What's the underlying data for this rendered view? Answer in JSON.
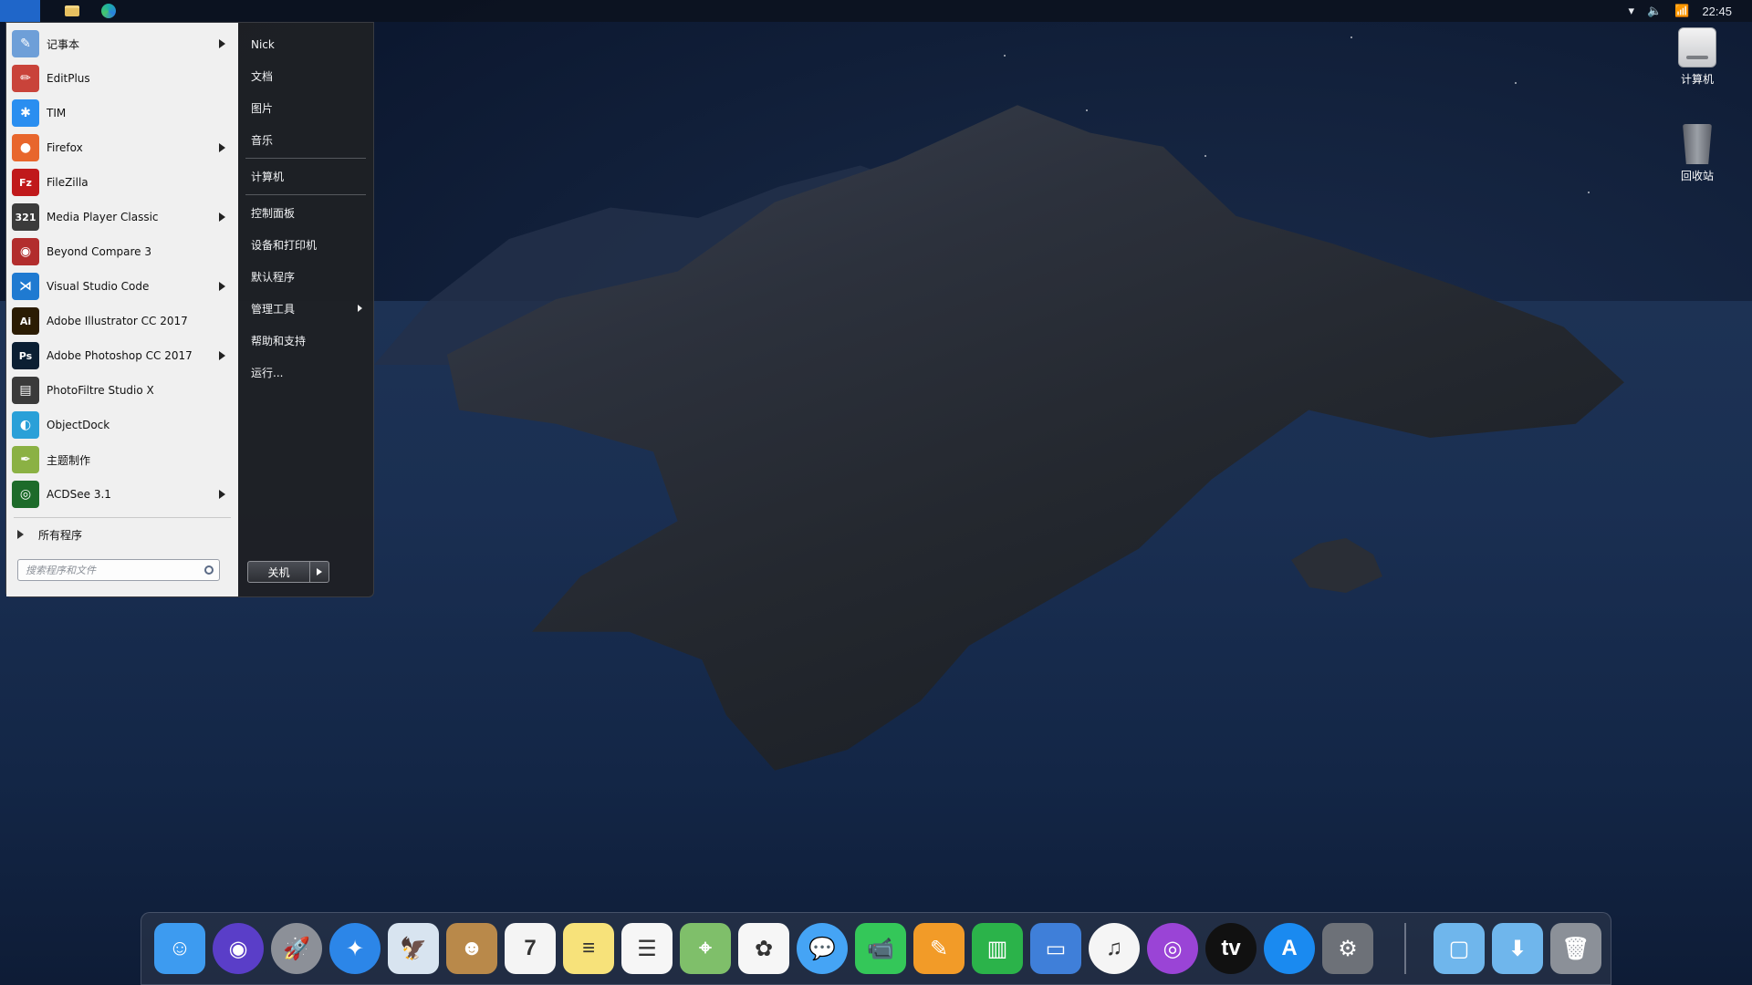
{
  "menubar": {
    "apple_glyph": "",
    "left_icons": [
      "folder-icon",
      "edge-browser-icon"
    ],
    "tray": {
      "dropdown_glyph": "▾",
      "volume_glyph": "🔈",
      "signal_glyph": "📶",
      "time": "22:45"
    }
  },
  "desktop_icons": [
    {
      "label": "计算机",
      "icon": "computer-drive-icon"
    },
    {
      "label": "回收站",
      "icon": "recycle-bin-icon"
    }
  ],
  "start_menu": {
    "programs": [
      {
        "label": "记事本",
        "icon": "notepad-icon",
        "has_submenu": true,
        "color": "#6e9fd8",
        "glyph": "✎"
      },
      {
        "label": "EditPlus",
        "icon": "editplus-icon",
        "has_submenu": false,
        "color": "#c9433a",
        "glyph": "✏"
      },
      {
        "label": "TIM",
        "icon": "tim-icon",
        "has_submenu": false,
        "color": "#2a8ef0",
        "glyph": "✱"
      },
      {
        "label": "Firefox",
        "icon": "firefox-icon",
        "has_submenu": true,
        "color": "#e8662c",
        "glyph": "●"
      },
      {
        "label": "FileZilla",
        "icon": "filezilla-icon",
        "has_submenu": false,
        "color": "#c0191b",
        "glyph": "Fz"
      },
      {
        "label": "Media Player Classic",
        "icon": "media-player-icon",
        "has_submenu": true,
        "color": "#3b3b3b",
        "glyph": "321"
      },
      {
        "label": "Beyond Compare 3",
        "icon": "beyond-compare-icon",
        "has_submenu": false,
        "color": "#b22d2d",
        "glyph": "◉"
      },
      {
        "label": "Visual Studio Code",
        "icon": "vscode-icon",
        "has_submenu": true,
        "color": "#1f7ad1",
        "glyph": "⋊"
      },
      {
        "label": "Adobe Illustrator CC 2017",
        "icon": "illustrator-icon",
        "has_submenu": false,
        "color": "#2b1c03",
        "glyph": "Ai"
      },
      {
        "label": "Adobe Photoshop CC 2017",
        "icon": "photoshop-icon",
        "has_submenu": true,
        "color": "#0b1f33",
        "glyph": "Ps"
      },
      {
        "label": "PhotoFiltre Studio X",
        "icon": "photofiltre-icon",
        "has_submenu": false,
        "color": "#3a3a3a",
        "glyph": "▤"
      },
      {
        "label": "ObjectDock",
        "icon": "objectdock-icon",
        "has_submenu": false,
        "color": "#2aa0d8",
        "glyph": "◐"
      },
      {
        "label": "主题制作",
        "icon": "theme-maker-icon",
        "has_submenu": false,
        "color": "#8bb144",
        "glyph": "✒"
      },
      {
        "label": "ACDSee 3.1",
        "icon": "acdsee-icon",
        "has_submenu": true,
        "color": "#1d6b2a",
        "glyph": "◎"
      }
    ],
    "all_programs": "所有程序",
    "search_placeholder": "搜索程序和文件",
    "places": [
      {
        "label": "Nick",
        "group": 1
      },
      {
        "label": "文档",
        "group": 1
      },
      {
        "label": "图片",
        "group": 1
      },
      {
        "label": "音乐",
        "group": 1
      },
      {
        "label": "计算机",
        "group": 2
      },
      {
        "label": "控制面板",
        "group": 3
      },
      {
        "label": "设备和打印机",
        "group": 3
      },
      {
        "label": "默认程序",
        "group": 3
      },
      {
        "label": "管理工具",
        "group": 3,
        "has_submenu": true
      },
      {
        "label": "帮助和支持",
        "group": 3
      },
      {
        "label": "运行...",
        "group": 3
      }
    ],
    "shutdown_label": "关机"
  },
  "dock": {
    "apps": [
      {
        "name": "finder-icon",
        "bg": "#3d9bf0",
        "glyph": "☺"
      },
      {
        "name": "siri-icon",
        "bg": "#5a3ec8",
        "glyph": "◉",
        "round": true
      },
      {
        "name": "launchpad-icon",
        "bg": "#8c9098",
        "glyph": "🚀",
        "round": true
      },
      {
        "name": "safari-icon",
        "bg": "#2c86e8",
        "glyph": "✦",
        "round": true
      },
      {
        "name": "mail-icon",
        "bg": "#d8e4f0",
        "glyph": "🦅"
      },
      {
        "name": "contacts-icon",
        "bg": "#b9894a",
        "glyph": "☻"
      },
      {
        "name": "calendar-icon",
        "bg": "#f4f4f4",
        "glyph": "7"
      },
      {
        "name": "notes-icon",
        "bg": "#f7e27a",
        "glyph": "≡"
      },
      {
        "name": "reminders-icon",
        "bg": "#f6f6f6",
        "glyph": "☰"
      },
      {
        "name": "maps-icon",
        "bg": "#7fbf6a",
        "glyph": "⌖"
      },
      {
        "name": "photos-icon",
        "bg": "#f6f6f6",
        "glyph": "✿"
      },
      {
        "name": "messages-icon",
        "bg": "#45a4f5",
        "glyph": "💬",
        "round": true
      },
      {
        "name": "facetime-icon",
        "bg": "#34c759",
        "glyph": "📹"
      },
      {
        "name": "pages-icon",
        "bg": "#f29b28",
        "glyph": "✎"
      },
      {
        "name": "numbers-icon",
        "bg": "#2bb34a",
        "glyph": "▥"
      },
      {
        "name": "keynote-icon",
        "bg": "#3f7fd9",
        "glyph": "▭"
      },
      {
        "name": "itunes-icon",
        "bg": "#f5f5f5",
        "glyph": "♫",
        "round": true
      },
      {
        "name": "podcasts-icon",
        "bg": "#9a44d6",
        "glyph": "◎",
        "round": true
      },
      {
        "name": "apple-tv-icon",
        "bg": "#111111",
        "glyph": "tv",
        "round": true
      },
      {
        "name": "app-store-icon",
        "bg": "#1a8af0",
        "glyph": "A",
        "round": true
      },
      {
        "name": "system-preferences-icon",
        "bg": "#6d7178",
        "glyph": "⚙"
      }
    ],
    "right": [
      {
        "name": "documents-folder-icon",
        "bg": "#6fb6ec",
        "glyph": "▢"
      },
      {
        "name": "downloads-folder-icon",
        "bg": "#6fb6ec",
        "glyph": "⬇"
      },
      {
        "name": "trash-icon",
        "bg": "#8b9098",
        "glyph": "🗑"
      }
    ]
  }
}
